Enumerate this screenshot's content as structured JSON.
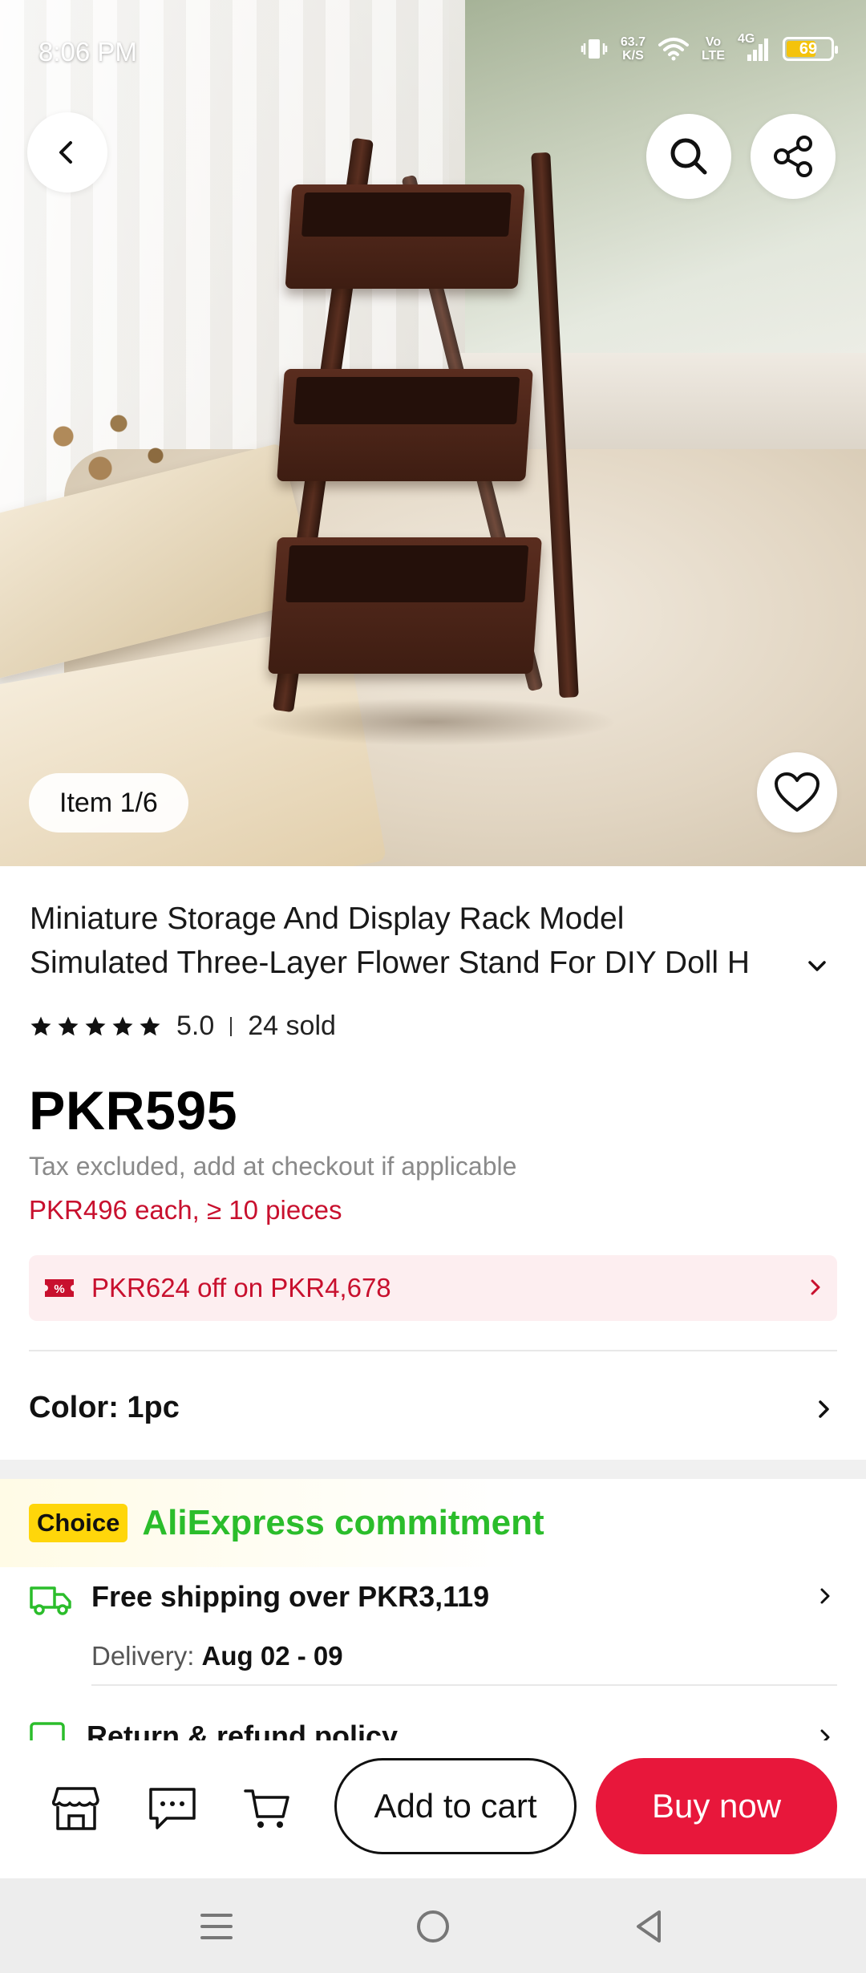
{
  "status_bar": {
    "time": "8:06 PM",
    "net_speed_value": "63.7",
    "net_speed_unit": "K/S",
    "volte_top": "Vo",
    "volte_bottom": "LTE",
    "network": "4G",
    "battery": "69",
    "battery_level": 0.69,
    "icons": [
      "vibrate-icon",
      "wifi-icon",
      "signal-icon",
      "battery-icon"
    ]
  },
  "gallery": {
    "counter": "Item 1/6",
    "buttons": [
      "back-icon",
      "search-icon",
      "share-icon",
      "heart-icon"
    ]
  },
  "product": {
    "title_line1": "Miniature Storage And Display Rack Model",
    "title_line2": "Simulated Three-Layer Flower Stand For DIY Doll H",
    "rating": "5.0",
    "stars": 5,
    "sold": "24 sold",
    "price": "PKR595",
    "tax_note": "Tax excluded, add at checkout if applicable",
    "bulk_price": "PKR496 each, ≥ 10 pieces"
  },
  "coupon": {
    "text": "PKR624 off on PKR4,678",
    "icon": "discount-tag-icon",
    "icon_label": "%"
  },
  "variant": {
    "label": "Color: 1pc"
  },
  "commitment": {
    "badge": "Choice",
    "title": "AliExpress commitment",
    "shipping_title": "Free shipping over PKR3,119",
    "delivery_label": "Delivery: ",
    "delivery_dates": "Aug 02 - 09",
    "return_title": "Return & refund policy"
  },
  "action_bar": {
    "add_to_cart": "Add to cart",
    "buy_now": "Buy now",
    "icons": [
      "store-icon",
      "message-icon",
      "cart-icon"
    ]
  },
  "colors": {
    "accent_red": "#e8173b",
    "price_red": "#c8102e",
    "coupon_bg": "#fdeef0",
    "choice_yellow": "#ffd60a",
    "commit_green": "#2bbd2b",
    "battery_yellow": "#f4c30b"
  }
}
